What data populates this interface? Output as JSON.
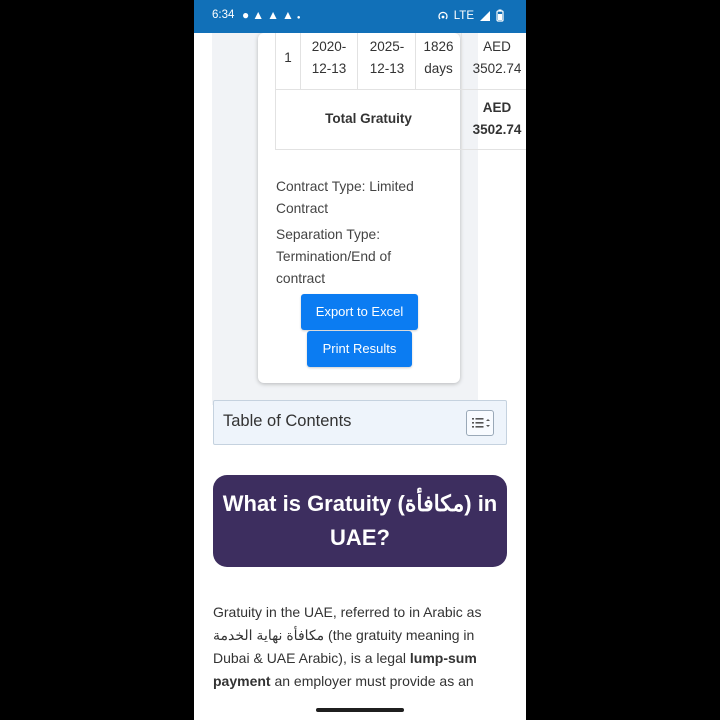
{
  "status_bar": {
    "time": "6:34",
    "notification_icons": [
      "chat-icon",
      "snapchat-icon",
      "snapchat-icon",
      "snapchat-icon"
    ],
    "network": "LTE"
  },
  "results_table": {
    "row": {
      "index": "1",
      "start_date_line1": "2020-",
      "start_date_line2": "12-13",
      "end_date_line1": "2025-",
      "end_date_line2": "12-13",
      "days_line1": "1826",
      "days_line2": "days",
      "amount_line1": "AED",
      "amount_line2": "3502.74"
    },
    "total": {
      "label": "Total Gratuity",
      "amount_line1": "AED",
      "amount_line2": "3502.74"
    }
  },
  "contract": {
    "type_line1": "Contract Type: Limited",
    "type_line2": "Contract",
    "separation_line1": "Separation Type:",
    "separation_line2": "Termination/End of",
    "separation_line3": "contract"
  },
  "buttons": {
    "export": "Export to Excel",
    "print": "Print Results"
  },
  "toc": {
    "title": "Table of Contents",
    "toggle_icon": "list-toggle-icon"
  },
  "section_heading": {
    "line1": "What is Gratuity (مكافأة) in",
    "line2": "UAE?"
  },
  "paragraph": {
    "line1": "Gratuity in the UAE, referred to in Arabic as",
    "line2_arabic": "مكافأة نهاية الخدمة",
    "line2_rest": " (the gratuity meaning in",
    "line3": "Dubai & UAE Arabic), is a legal ",
    "line3_bold": "lump-sum",
    "line4_bold": "payment",
    "line4_rest": " an employer must provide as an"
  },
  "colors": {
    "status_bar": "#1170b8",
    "button": "#0b7cf2",
    "heading_bg": "#3d2e5f",
    "toc_bg": "#eef4fb"
  }
}
